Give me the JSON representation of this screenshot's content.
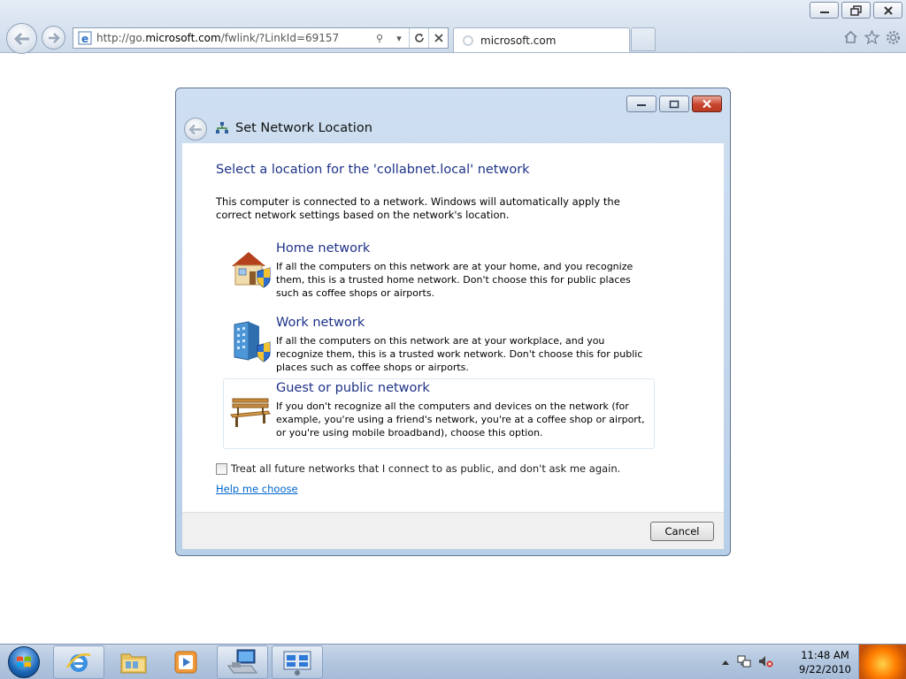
{
  "browser": {
    "url_prefix": "http://go.",
    "url_domain": "microsoft.com",
    "url_rest": "/fwlink/?LinkId=69157",
    "tab_title": "microsoft.com"
  },
  "dialog": {
    "title": "Set Network Location",
    "heading": "Select a location for the 'collabnet.local' network",
    "intro": "This computer is connected to a network. Windows will automatically apply the correct network settings based on the network's location.",
    "options": [
      {
        "name": "Home network",
        "desc": "If all the computers on this network are at your home, and you recognize them, this is a trusted home network.  Don't choose this for public places such as coffee shops or airports."
      },
      {
        "name": "Work network",
        "desc": "If all the computers on this network are at your workplace, and you recognize them, this is a trusted work network.  Don't choose this for public places such as coffee shops or airports."
      },
      {
        "name": "Guest or public network",
        "desc": "If you don't recognize all the computers and devices on the network (for example, you're using a friend's network, you're at a coffee shop or airport, or you're using mobile broadband), choose this option."
      }
    ],
    "checkbox_label": "Treat all future networks that I connect to as public, and don't ask me again.",
    "help_link": "Help me choose",
    "cancel_label": "Cancel"
  },
  "taskbar": {
    "time": "11:48 AM",
    "date": "9/22/2010"
  },
  "colors": {
    "heading_blue": "#1e3287",
    "link_blue": "#0066cc"
  }
}
